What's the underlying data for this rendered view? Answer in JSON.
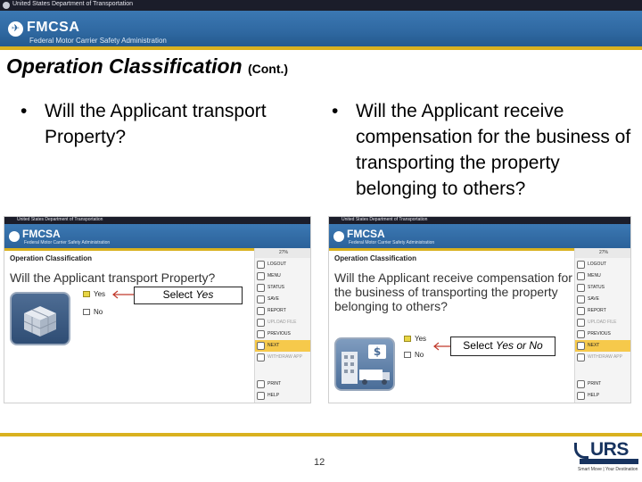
{
  "header": {
    "dept_text": "United States Department of Transportation",
    "logo_title": "FMCSA",
    "logo_subtitle": "Federal Motor Carrier Safety Administration"
  },
  "slide": {
    "title": "Operation Classification",
    "title_suffix": "(Cont.)",
    "bullets": [
      {
        "marker": "•",
        "text": "Will the Applicant transport Property?"
      },
      {
        "marker": "•",
        "text": "Will the Applicant receive compensation for the business of transporting the property belonging to others?"
      }
    ],
    "page_number": "12",
    "footer_logo": "URS",
    "footer_logo_sub": "Smart Move | Your Destination"
  },
  "screens": [
    {
      "dept_text": "United States Department of Transportation",
      "logo_title": "FMCSA",
      "logo_subtitle": "Federal Motor Carrier Safety Administration",
      "heading": "Operation Classification",
      "question": "Will the Applicant transport Property?",
      "options": [
        {
          "label": "Yes",
          "checked": true
        },
        {
          "label": "No",
          "checked": false
        }
      ],
      "callout_prefix": "Select",
      "callout_emph": "Yes",
      "progress": "27%",
      "menu": [
        "LOGOUT",
        "MENU",
        "STATUS",
        "SAVE",
        "REPORT",
        "UPLOAD FILE",
        "PREVIOUS",
        "NEXT",
        "WITHDRAW APP",
        "PRINT",
        "HELP"
      ]
    },
    {
      "dept_text": "United States Department of Transportation",
      "logo_title": "FMCSA",
      "logo_subtitle": "Federal Motor Carrier Safety Administration",
      "heading": "Operation Classification",
      "question": "Will the Applicant receive compensation for the business of transporting the property belonging to others?",
      "options": [
        {
          "label": "Yes",
          "checked": true
        },
        {
          "label": "No",
          "checked": false
        }
      ],
      "callout_prefix": "Select",
      "callout_emph": "Yes or No",
      "progress": "27%",
      "menu": [
        "LOGOUT",
        "MENU",
        "STATUS",
        "SAVE",
        "REPORT",
        "UPLOAD FILE",
        "PREVIOUS",
        "NEXT",
        "WITHDRAW APP",
        "PRINT",
        "HELP"
      ]
    }
  ],
  "colors": {
    "banner_blue": "#2f68a1",
    "accent_gold": "#d9b11f",
    "menu_highlight": "#f6c94b",
    "urs_navy": "#17335f"
  }
}
